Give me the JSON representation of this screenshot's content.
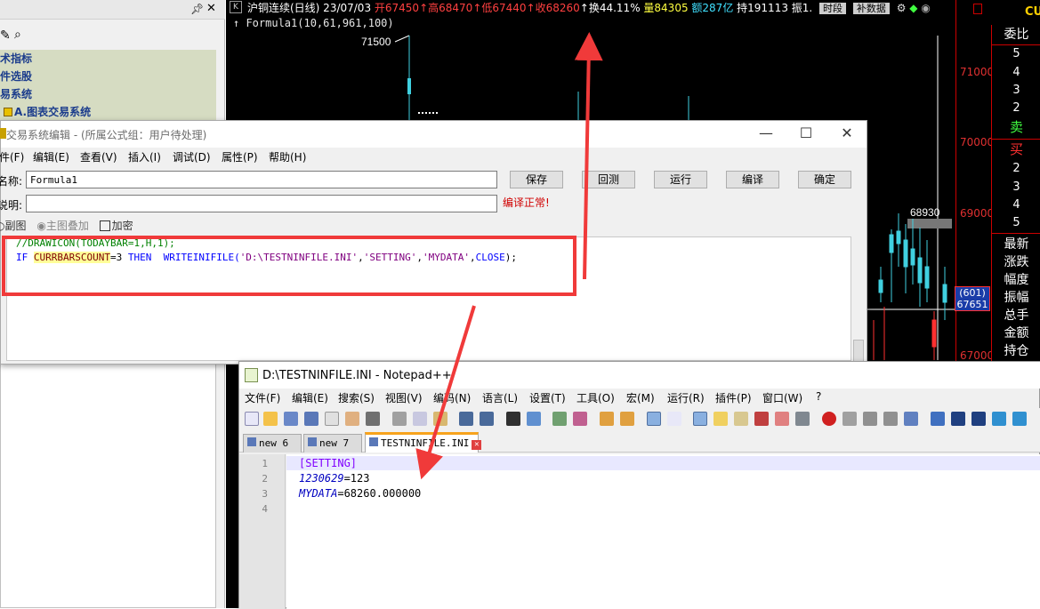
{
  "left_panel": {
    "items": [
      "术指标",
      "件选股",
      "易系统",
      "A.图表交易系统"
    ]
  },
  "chart": {
    "title_parts": [
      {
        "text": "沪铜连续(日线) 23/07/03",
        "color": "#ffffff"
      },
      {
        "text": " 开67450",
        "color": "#ff4040"
      },
      {
        "text": "↑高68470",
        "color": "#ff4040"
      },
      {
        "text": "↑低67440",
        "color": "#ff4040"
      },
      {
        "text": "↑收68260",
        "color": "#ff4040"
      },
      {
        "text": "↑换44.11%",
        "color": "#ffffff"
      },
      {
        "text": " 量84305",
        "color": "#ffff40"
      },
      {
        "text": " 额287亿",
        "color": "#40e0ff"
      },
      {
        "text": " 持191113",
        "color": "#ffffff"
      },
      {
        "text": " 振1.",
        "color": "#ffffff"
      }
    ],
    "title_buttons": [
      "时段",
      "补数据"
    ],
    "formula_line": "↑ Formula1(10,61,961,100)",
    "peak_label": "71500",
    "low_label": "68930",
    "price_levels": [
      "71000",
      "70000",
      "69000",
      "67000"
    ],
    "current_box": [
      "(601)",
      "67651"
    ],
    "symbol": "CU",
    "order_panel": {
      "header": "委比",
      "sell_levels": [
        "5",
        "4",
        "3",
        "2"
      ],
      "sell_label": "卖",
      "buy_label": "买",
      "buy_levels": [
        "2",
        "3",
        "4",
        "5"
      ],
      "stats": [
        "最新",
        "涨跌",
        "幅度",
        "振幅",
        "总手",
        "金额",
        "持仓"
      ]
    }
  },
  "editor": {
    "title": "交易系统编辑 - (所属公式组：用户待处理)",
    "menu": [
      "件(F)",
      "编辑(E)",
      "查看(V)",
      "插入(I)",
      "调试(D)",
      "属性(P)",
      "帮助(H)"
    ],
    "name_label": "名称:",
    "name_value": "Formula1",
    "desc_label": "说明:",
    "desc_value": "",
    "buttons": [
      "保存",
      "回测",
      "运行",
      "编译",
      "确定"
    ],
    "compile_status": "编译正常!",
    "options": [
      "副图",
      "主图叠加",
      "加密"
    ],
    "code_line1": "//DRAWICON(TODAYBAR=1,H,1);",
    "code_line2": {
      "kw_if": "IF",
      "fn": "CURRBARSCOUNT",
      "op": "=3",
      "kw_then": "THEN",
      "call": "WRITEINIFILE(",
      "arg1": "'D:\\TESTNINFILE.INI'",
      "arg2": "'SETTING'",
      "arg3": "'MYDATA'",
      "arg4": "CLOSE",
      "tail": ");"
    }
  },
  "notepad": {
    "title": "D:\\TESTNINFILE.INI - Notepad++",
    "menu": [
      "文件(F)",
      "编辑(E)",
      "搜索(S)",
      "视图(V)",
      "编码(N)",
      "语言(L)",
      "设置(T)",
      "工具(O)",
      "宏(M)",
      "运行(R)",
      "插件(P)",
      "窗口(W)",
      "?"
    ],
    "tabs": [
      "new 6",
      "new 7",
      "TESTNINFILE.INI"
    ],
    "line_numbers": [
      "1",
      "2",
      "3",
      "4"
    ],
    "lines": {
      "section": "[SETTING]",
      "key1": "1230629",
      "val1": "=123",
      "key2": "MYDATA",
      "val2": "=68260.000000"
    }
  }
}
